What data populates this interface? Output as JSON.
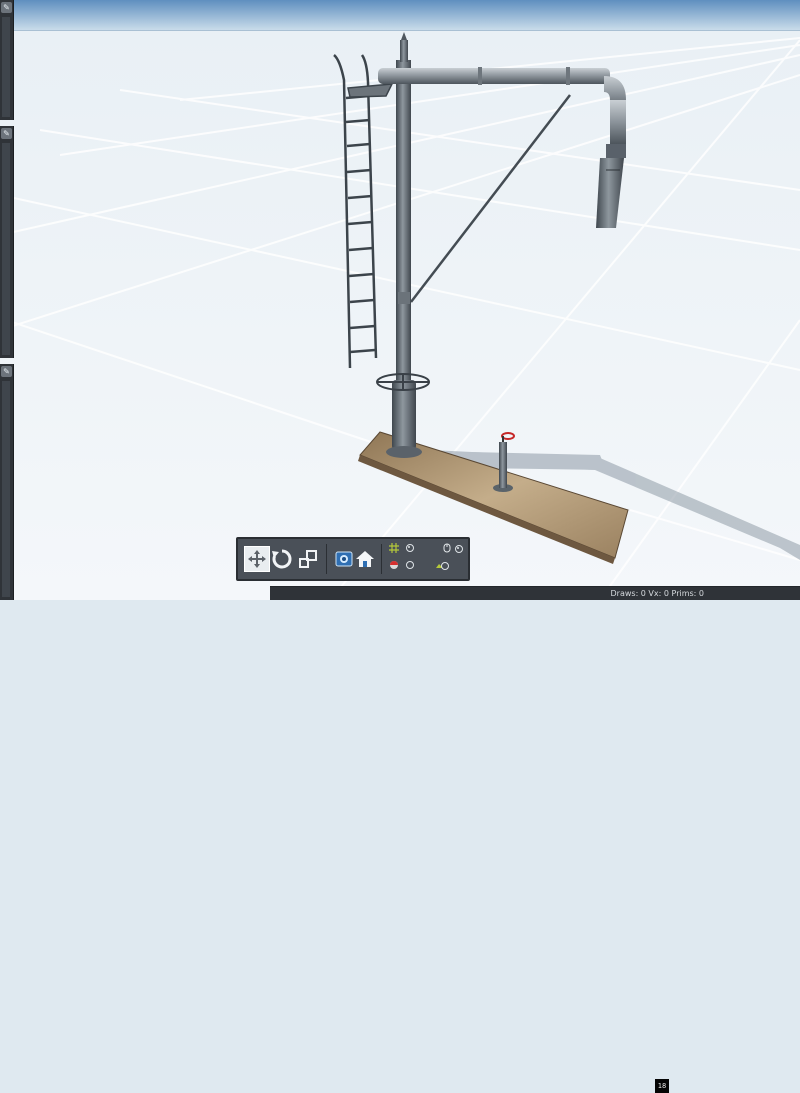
{
  "toolbar": {
    "tools": [
      {
        "icon": "move-icon",
        "active": true
      },
      {
        "icon": "rotate-icon",
        "active": false
      },
      {
        "icon": "scale-icon",
        "active": false
      }
    ],
    "view_buttons": [
      {
        "icon": "camera-view-icon"
      },
      {
        "icon": "home-icon"
      }
    ],
    "counter_value": "18"
  },
  "status": {
    "text": "Draws: 0 Vx: 0 Prims: 0"
  },
  "colors": {
    "panel": "#2f3338",
    "toolbar": "#4a5058",
    "sky_top": "#5f8fbf",
    "ground": "#f2f6f9"
  }
}
